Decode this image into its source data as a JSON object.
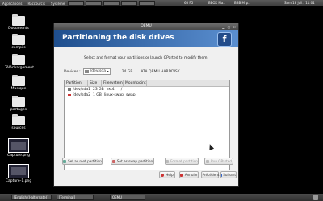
{
  "top_panel": {
    "menus": [
      "Applications",
      "Raccourcis",
      "Système"
    ],
    "tasks": [
      "",
      "",
      "",
      "",
      "",
      "",
      ""
    ],
    "tray": [
      "68 F5",
      "BBOX Ma..",
      "BBB Mrp..",
      "Sam 18 juil., 11:01"
    ]
  },
  "desktop_icons": [
    {
      "label": "Documents",
      "kind": "folder"
    },
    {
      "label": "compils",
      "kind": "folder"
    },
    {
      "label": "Téléchargement",
      "kind": "folder"
    },
    {
      "label": "Musique",
      "kind": "folder"
    },
    {
      "label": "partages",
      "kind": "folder"
    },
    {
      "label": "sources",
      "kind": "folder"
    },
    {
      "label": "Capture.png",
      "kind": "image"
    },
    {
      "label": "Capture-1.png",
      "kind": "image"
    }
  ],
  "window": {
    "title": "QEMU",
    "heading": "Partitioning the disk drives",
    "instructions": "Select and format your partitions or launch GParted to modify them.",
    "devices_label": "Devices :",
    "device_value": "/dev/sda",
    "device_size": "24 GB",
    "device_model": "ATA QEMU HARDDISK",
    "columns": [
      "Partition",
      "Size",
      "Filesystem",
      "Mountpoint"
    ],
    "partitions": [
      {
        "device": "/dev/sda1",
        "size": "23 GB",
        "fs": "ext4",
        "mount": "/"
      },
      {
        "device": "/dev/sda2",
        "size": "1 GB",
        "fs": "linux-swap",
        "mount": "swap"
      }
    ],
    "buttons": {
      "set_root": "Set as root partition",
      "set_swap": "Set as swap partition",
      "format": "Format partition",
      "run_gparted": "Run GParted",
      "help": "Help",
      "cancel": "Annuler",
      "previous": "Précédent",
      "next": "Suivant"
    },
    "accent": "#1f4f8e"
  },
  "bottom_panel": {
    "tasks": [
      "[English (I-alternate)]",
      "[Terminal]",
      "QEMU"
    ]
  }
}
